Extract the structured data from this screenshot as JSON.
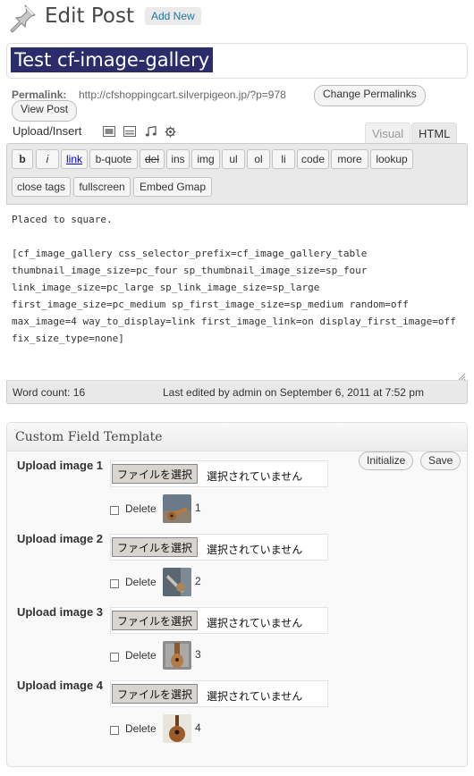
{
  "header": {
    "title": "Edit Post",
    "add_new": "Add New"
  },
  "post": {
    "title": "Test cf-image-gallery"
  },
  "permalink": {
    "label": "Permalink:",
    "url": "http://cfshoppingcart.silverpigeon.jp/?p=978",
    "change_button": "Change Permalinks",
    "view_button": "View Post"
  },
  "upload": {
    "label": "Upload/Insert",
    "icons": [
      "image-icon",
      "video-icon",
      "music-icon",
      "media-gear-icon"
    ]
  },
  "tabs": {
    "visual": "Visual",
    "html": "HTML"
  },
  "quicktags": {
    "row1": [
      "b",
      "i",
      "link",
      "b-quote",
      "del",
      "ins",
      "img",
      "ul",
      "ol",
      "li",
      "code",
      "more",
      "lookup"
    ],
    "row2": [
      "close tags",
      "fullscreen",
      "Embed Gmap"
    ]
  },
  "editor": {
    "content": "Placed to square.\n\n[cf_image_gallery css_selector_prefix=cf_image_gallery_table thumbnail_image_size=pc_four sp_thumbnail_image_size=sp_four link_image_size=pc_large sp_link_image_size=sp_large first_image_size=pc_medium sp_first_image_size=sp_medium random=off max_image=4 way_to_display=link first_image_link=on display_first_image=off fix_size_type=none]",
    "word_count": "Word count: 16",
    "last_edited": "Last edited by admin on September 6, 2011 at 7:52 pm"
  },
  "cft": {
    "title": "Custom Field Template",
    "initialize": "Initialize",
    "save": "Save",
    "fields": [
      {
        "label": "Upload image 1",
        "button": "ファイルを選択",
        "status": "選択されていません",
        "delete": "Delete",
        "num": "1"
      },
      {
        "label": "Upload image 2",
        "button": "ファイルを選択",
        "status": "選択されていません",
        "delete": "Delete",
        "num": "2"
      },
      {
        "label": "Upload image 3",
        "button": "ファイルを選択",
        "status": "選択されていません",
        "delete": "Delete",
        "num": "3"
      },
      {
        "label": "Upload image 4",
        "button": "ファイルを選択",
        "status": "選択されていません",
        "delete": "Delete",
        "num": "4"
      }
    ]
  },
  "colors": {
    "title_highlight": "#2b2d6b",
    "link": "#21759b",
    "panel": "#f9f9f9"
  }
}
